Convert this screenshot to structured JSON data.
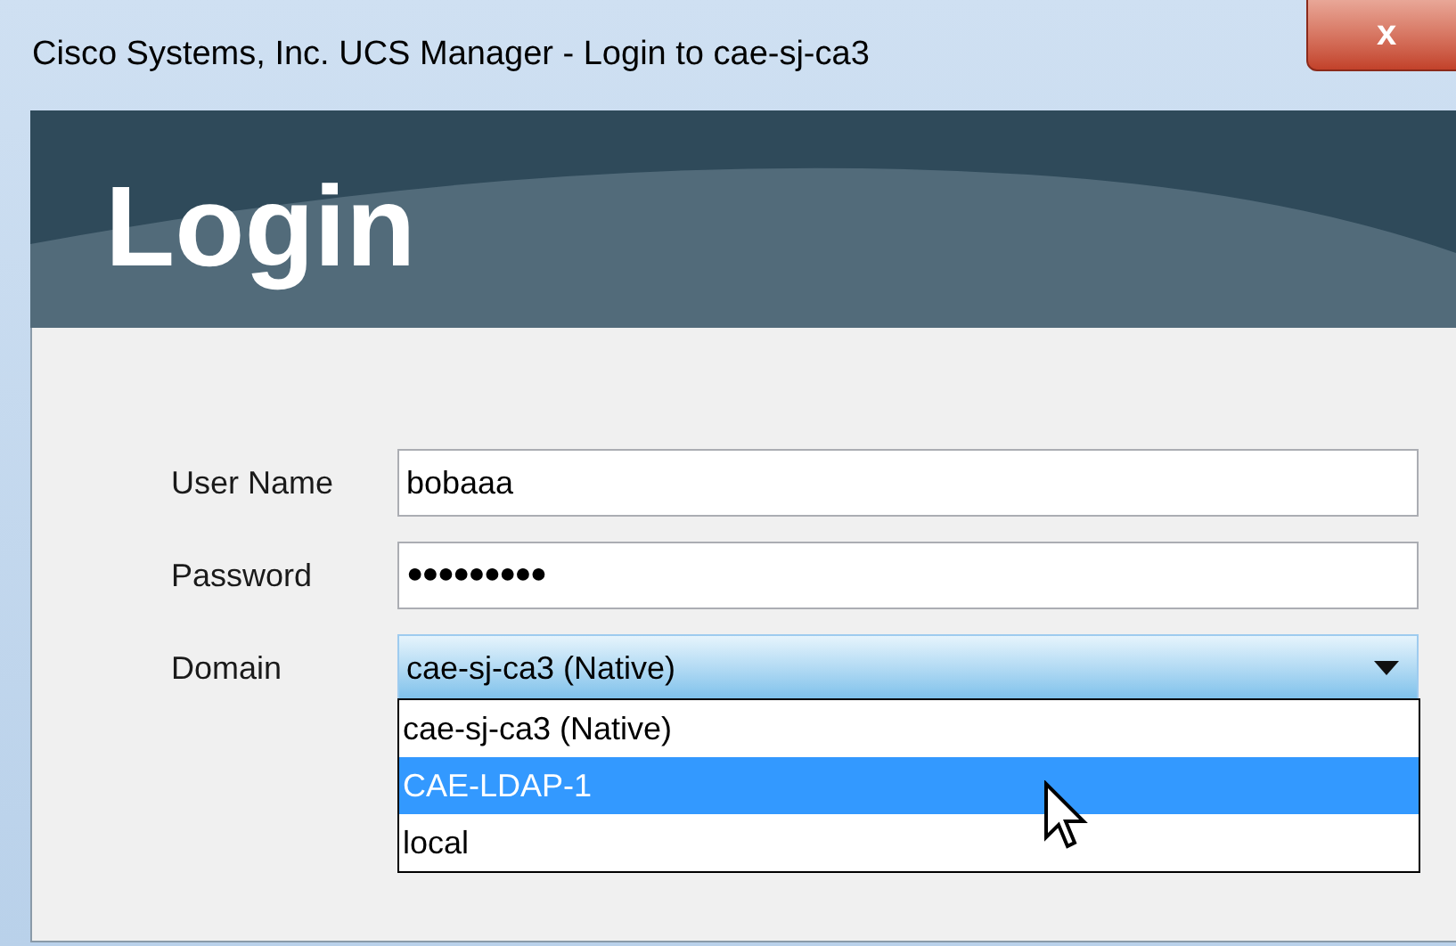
{
  "window": {
    "title": "Cisco Systems, Inc. UCS Manager - Login to cae-sj-ca3",
    "close": "x"
  },
  "header": {
    "title": "Login"
  },
  "form": {
    "user_name": {
      "label": "User Name",
      "value": "bobaaa"
    },
    "password": {
      "label": "Password",
      "value": "●●●●●●●●●"
    },
    "domain": {
      "label": "Domain",
      "value": "cae-sj-ca3 (Native)",
      "expanded": true,
      "options": [
        {
          "label": "cae-sj-ca3 (Native)",
          "highlighted": false
        },
        {
          "label": "CAE-LDAP-1",
          "highlighted": true
        },
        {
          "label": "local",
          "highlighted": false
        }
      ]
    }
  }
}
